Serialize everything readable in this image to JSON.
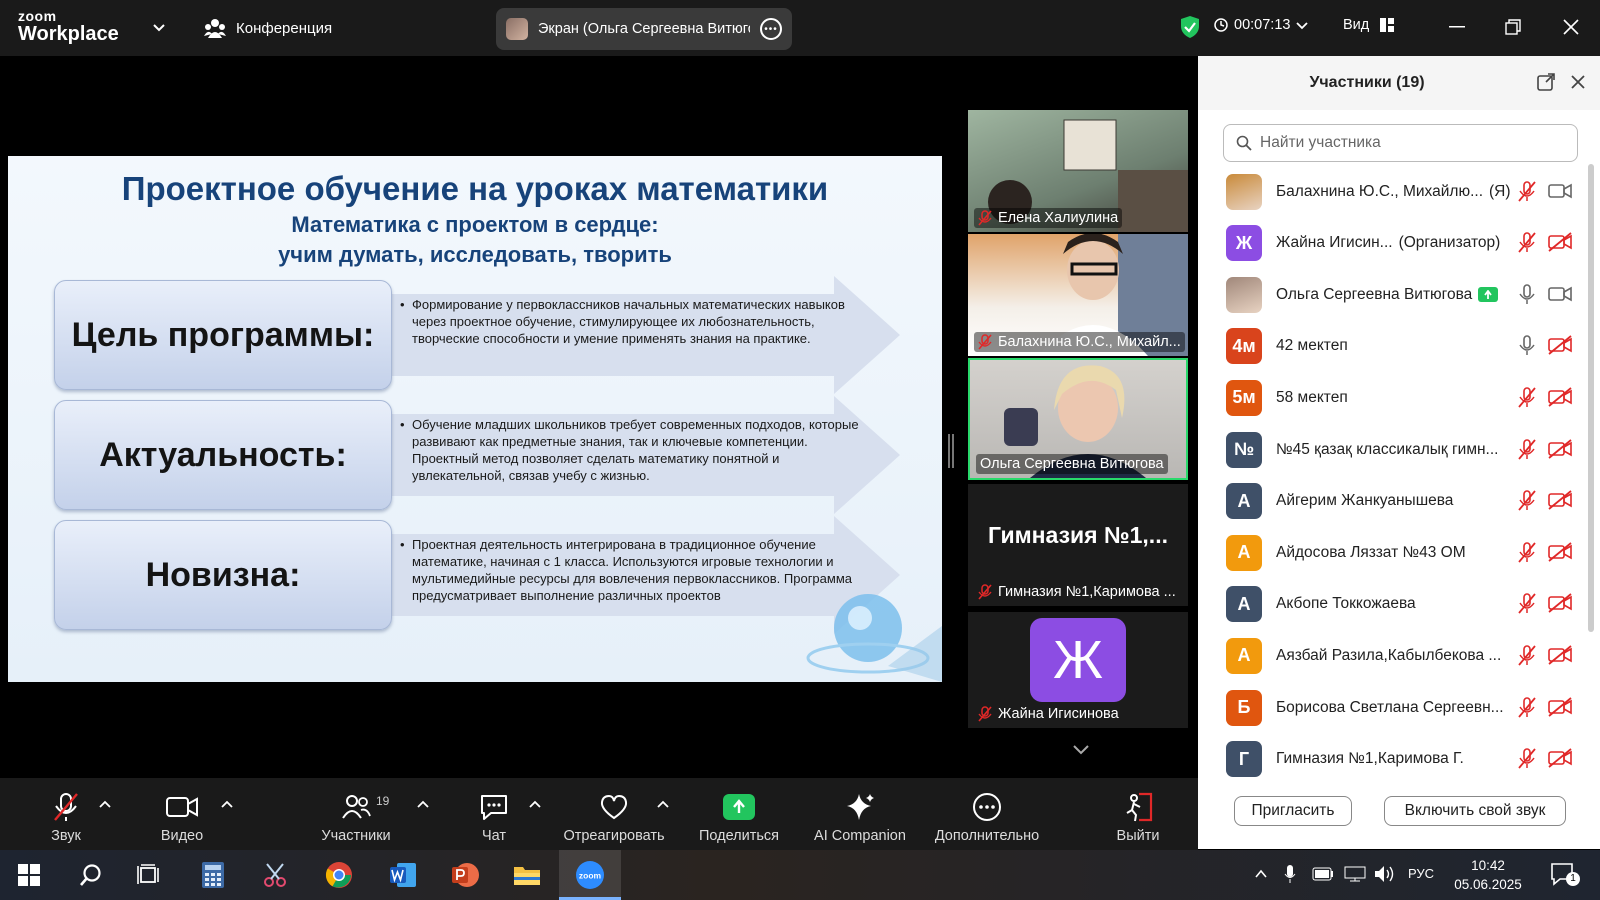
{
  "window": {
    "app_logo_top": "zoom",
    "app_logo_bottom": "Workplace",
    "meeting_label": "Конференция",
    "share_label": "Экран (Ольга Сергеевна Витюго",
    "timer": "00:07:13",
    "view_label": "Вид"
  },
  "slide": {
    "title": "Проектное обучение на уроках математики",
    "subtitle_line1": "Математика с проектом в сердце:",
    "subtitle_line2": "учим думать, исследовать, творить",
    "rows": [
      {
        "heading": "Цель программы:",
        "text": "Формирование у первоклассников начальных математических навыков через проектное обучение, стимулирующее их любознательность, творческие способности и умение применять знания на практике."
      },
      {
        "heading": "Актуальность:",
        "text": "Обучение младших школьников требует современных подходов, которые развивают как предметные знания, так и ключевые компетенции. Проектный метод позволяет сделать математику понятной и увлекательной, связав учебу с жизнью."
      },
      {
        "heading": "Новизна:",
        "text": "Проектная деятельность интегрирована в традиционное обучение математике, начиная с 1 класса. Используются игровые технологии и мультимедийные ресурсы для вовлечения первоклассников. Программа предусматривает выполнение различных проектов"
      }
    ]
  },
  "video_tiles": [
    {
      "name": "Елена Халиулина",
      "muted": true
    },
    {
      "name": "Балахнина Ю.С., Михайл...",
      "muted": true
    },
    {
      "name": "Ольга Сергеевна Витюгова",
      "muted": false
    },
    {
      "name": "Гимназия №1,Каримова ...",
      "muted": true,
      "display_text": "Гимназия №1,..."
    },
    {
      "name": "Жайна Игисинова",
      "muted": true,
      "avatar_letter": "Ж"
    }
  ],
  "participants_panel": {
    "title": "Участники (19)",
    "search_placeholder": "Найти участника",
    "invite_label": "Пригласить",
    "unmute_label": "Включить свой звук",
    "participants": [
      {
        "name": "Балахнина Ю.С., Михайлю...",
        "tag": "(Я)",
        "avatar": "",
        "avatar_color": "#c98a3a",
        "mic": "muted",
        "cam": "on"
      },
      {
        "name": "Жайна Игисин...",
        "tag": "(Организатор)",
        "avatar": "Ж",
        "avatar_color": "#8c4de3",
        "mic": "muted",
        "cam": "off"
      },
      {
        "name": "Ольга Сергеевна Витюгова",
        "tag": "",
        "avatar": "",
        "avatar_color": "#a0877a",
        "mic": "on",
        "cam": "on",
        "sharing": true
      },
      {
        "name": "42 мектеп",
        "tag": "",
        "avatar": "4м",
        "avatar_color": "#d9441c",
        "mic": "on",
        "cam": "off"
      },
      {
        "name": "58 мектеп",
        "tag": "",
        "avatar": "5м",
        "avatar_color": "#e0560f",
        "mic": "muted",
        "cam": "off"
      },
      {
        "name": "№45 қазақ классикалық гимн...",
        "tag": "",
        "avatar": "№",
        "avatar_color": "#3f5068",
        "mic": "muted",
        "cam": "off"
      },
      {
        "name": "Айгерим Жанкуанышева",
        "tag": "",
        "avatar": "А",
        "avatar_color": "#3f5068",
        "mic": "muted",
        "cam": "off"
      },
      {
        "name": "Айдосова Ляззат №43 ОМ",
        "tag": "",
        "avatar": "А",
        "avatar_color": "#f29a0d",
        "mic": "muted",
        "cam": "off"
      },
      {
        "name": "Акбопе Токкожаева",
        "tag": "",
        "avatar": "А",
        "avatar_color": "#3f5068",
        "mic": "muted",
        "cam": "off"
      },
      {
        "name": "Аязбай Разила,Кабылбекова ...",
        "tag": "",
        "avatar": "А",
        "avatar_color": "#f29a0d",
        "mic": "muted",
        "cam": "off"
      },
      {
        "name": "Борисова Светлана Сергеевн...",
        "tag": "",
        "avatar": "Б",
        "avatar_color": "#e0560f",
        "mic": "muted",
        "cam": "off"
      },
      {
        "name": "Гимназия №1,Каримова Г.",
        "tag": "",
        "avatar": "Г",
        "avatar_color": "#3f5068",
        "mic": "muted",
        "cam": "off"
      }
    ]
  },
  "toolbar": {
    "audio": "Звук",
    "video": "Видео",
    "participants": "Участники",
    "participants_count": "19",
    "chat": "Чат",
    "react": "Отреагировать",
    "share": "Поделиться",
    "ai": "AI Companion",
    "more": "Дополнительно",
    "leave": "Выйти"
  },
  "taskbar": {
    "language": "РУС",
    "time": "10:42",
    "date": "05.06.2025",
    "notifications": "1",
    "zoom_icon_text": "zoom"
  },
  "colors": {
    "accent_green": "#22c55e",
    "active_tile_border": "#29d96b",
    "muted_red": "#e02828",
    "slide_title": "#17437a"
  }
}
